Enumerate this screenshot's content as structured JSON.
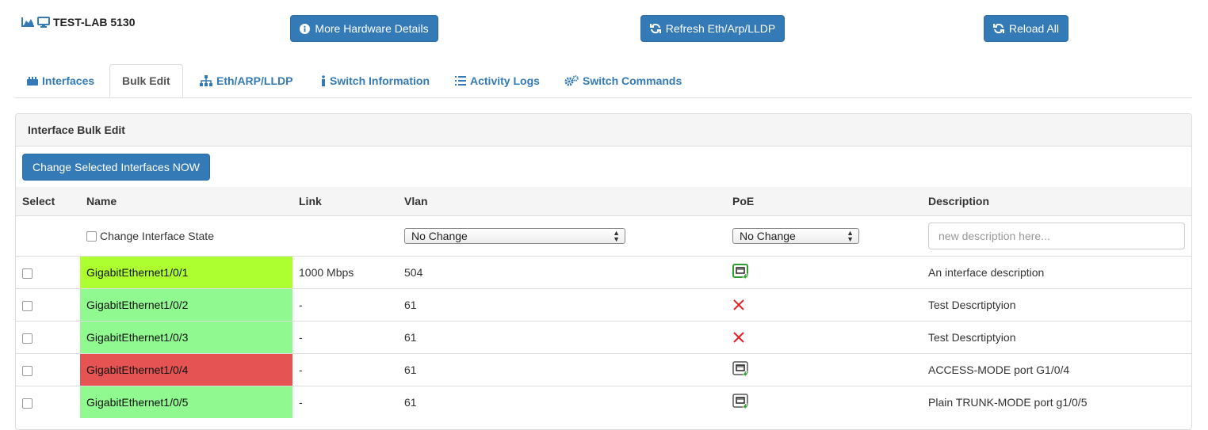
{
  "header": {
    "title": "TEST-LAB 5130",
    "buttons": {
      "hardware": "More Hardware Details",
      "refresh": "Refresh Eth/Arp/LLDP",
      "reload": "Reload All"
    }
  },
  "tabs": [
    {
      "label": "Interfaces",
      "icon": "plug-icon"
    },
    {
      "label": "Bulk Edit",
      "active": true
    },
    {
      "label": "Eth/ARP/LLDP",
      "icon": "sitemap-icon"
    },
    {
      "label": "Switch Information",
      "icon": "info-icon"
    },
    {
      "label": "Activity Logs",
      "icon": "list-icon"
    },
    {
      "label": "Switch Commands",
      "icon": "gears-icon"
    }
  ],
  "panel": {
    "title": "Interface Bulk Edit",
    "change_button": "Change Selected Interfaces NOW",
    "columns": [
      "Select",
      "Name",
      "Link",
      "Vlan",
      "PoE",
      "Description"
    ],
    "filters": {
      "change_state_label": "Change Interface State",
      "vlan_select": "No Change",
      "poe_select": "No Change",
      "description_placeholder": "new description here..."
    },
    "rows": [
      {
        "name": "GigabitEthernet1/0/1",
        "link": "1000 Mbps",
        "vlan": "504",
        "poe": "active",
        "description": "An interface description",
        "color": "#adff2f"
      },
      {
        "name": "GigabitEthernet1/0/2",
        "link": "-",
        "vlan": "61",
        "poe": "none",
        "description": "Test Descrtiptyion",
        "color": "#90f990"
      },
      {
        "name": "GigabitEthernet1/0/3",
        "link": "-",
        "vlan": "61",
        "poe": "none",
        "description": "Test Descrtiptyion",
        "color": "#90f990"
      },
      {
        "name": "GigabitEthernet1/0/4",
        "link": "-",
        "vlan": "61",
        "poe": "available",
        "description": "ACCESS-MODE port G1/0/4",
        "color": "#e55353"
      },
      {
        "name": "GigabitEthernet1/0/5",
        "link": "-",
        "vlan": "61",
        "poe": "available",
        "description": "Plain TRUNK-MODE port g1/0/5",
        "color": "#90f990"
      }
    ]
  },
  "colors": {
    "primary": "#337ab7",
    "link": "#337ab7"
  }
}
